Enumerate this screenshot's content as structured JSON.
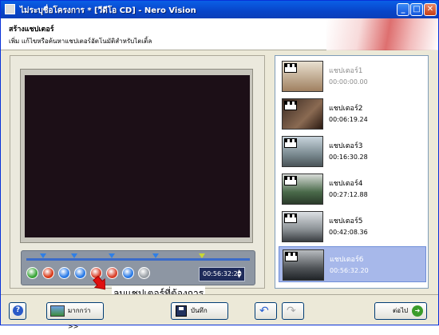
{
  "window": {
    "title": "ไม่ระบุชื่อโครงการ * [วีดีโอ CD] - Nero Vision",
    "min_label": "_",
    "max_label": "□",
    "close_label": "✕"
  },
  "header": {
    "title": "สร้างแชปเตอร์",
    "subtitle": "เพิ่ม แก้ไขหรือค้นหาแชปเตอร์อัตโนมัติสำหรับไตเติ้ล"
  },
  "player": {
    "time_value": "00:56:32:20",
    "spin_up": "▲",
    "spin_down": "▼",
    "buttons": [
      {
        "name": "play-button",
        "icon": "play-icon",
        "color": "#3aa53a"
      },
      {
        "name": "stop-button",
        "icon": "stop-icon",
        "color": "#d83a1a"
      },
      {
        "name": "add-chapter-button",
        "icon": "add-chapter-icon",
        "color": "#2a7ae6"
      },
      {
        "name": "detect-chapters-button",
        "icon": "detect-chapters-icon",
        "color": "#2a7ae6"
      },
      {
        "name": "delete-chapter-button",
        "icon": "delete-chapter-icon",
        "color": "#d8402a"
      },
      {
        "name": "delete-all-chapters-button",
        "icon": "delete-all-icon",
        "color": "#d8402a"
      },
      {
        "name": "move-chapter-button",
        "icon": "move-chapter-icon",
        "color": "#2a7ae6"
      },
      {
        "name": "settings-button",
        "icon": "gear-icon",
        "color": "#9aa0a6"
      }
    ]
  },
  "annotation": {
    "text": "ลบแชปเตอร์ที่ต้องการ"
  },
  "chapters": [
    {
      "name": "แชปเตอร์1",
      "time": "00:00:00.00",
      "state": "dim"
    },
    {
      "name": "แชปเตอร์2",
      "time": "00:06:19.24",
      "state": "normal"
    },
    {
      "name": "แชปเตอร์3",
      "time": "00:16:30.28",
      "state": "normal"
    },
    {
      "name": "แชปเตอร์4",
      "time": "00:27:12.88",
      "state": "normal"
    },
    {
      "name": "แชปเตอร์5",
      "time": "00:42:08.36",
      "state": "normal"
    },
    {
      "name": "แชปเตอร์6",
      "time": "00:56:32.20",
      "state": "selected"
    }
  ],
  "bottom": {
    "help_label": "?",
    "more_label": "มากกว่า >>",
    "save_label": "บันทึก",
    "undo_label": "↶",
    "redo_label": "↷",
    "next_label": "ต่อไป",
    "next_arrow": "➜"
  },
  "colors": {
    "titlebar": "#0845c9",
    "selected_chapter": "#a7b8ea",
    "annotation_arrow": "#e01010"
  }
}
